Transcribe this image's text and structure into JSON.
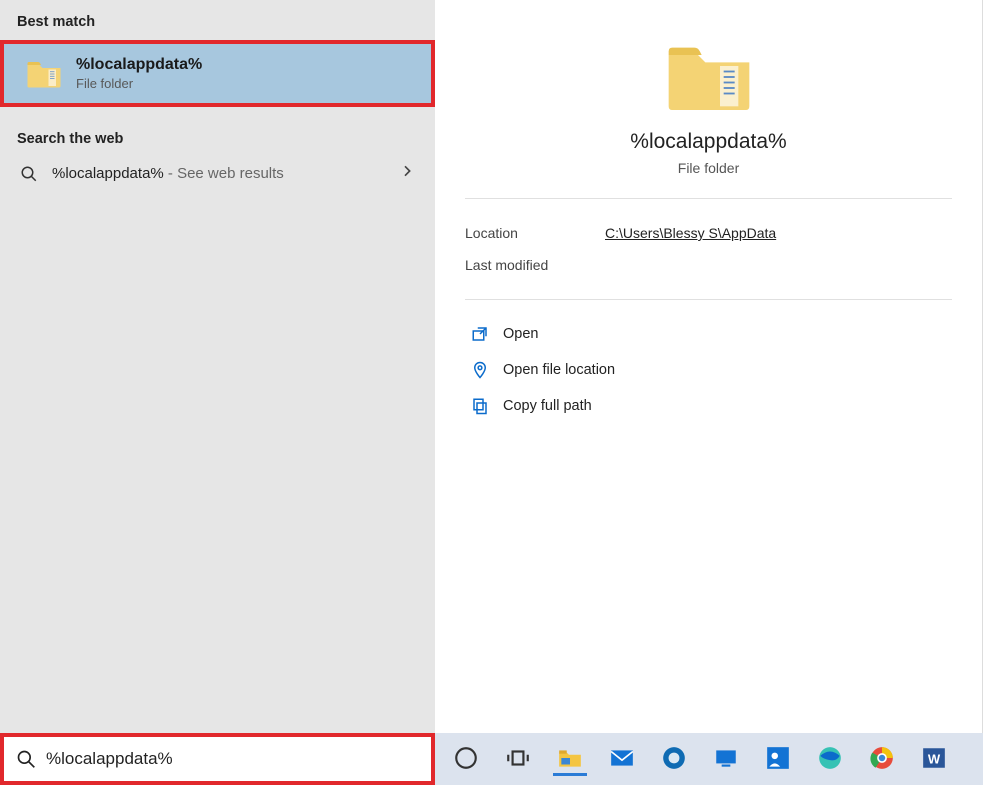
{
  "left": {
    "best_match_header": "Best match",
    "item_title": "%localappdata%",
    "item_sub": "File folder",
    "web_header": "Search the web",
    "web_query": "%localappdata%",
    "web_suffix": " - See web results"
  },
  "details": {
    "title": "%localappdata%",
    "sub": "File folder",
    "location_label": "Location",
    "location_value": "C:\\Users\\Blessy S\\AppData",
    "modified_label": "Last modified",
    "modified_value": "",
    "actions": {
      "open": "Open",
      "open_loc": "Open file location",
      "copy_path": "Copy full path"
    }
  },
  "search": {
    "value": "%localappdata%"
  },
  "taskbar": {
    "cortana": "cortana",
    "taskview": "task-view",
    "explorer": "file-explorer",
    "mail": "mail",
    "app5": "dell",
    "app6": "surface",
    "app7": "feedback",
    "edge": "edge",
    "chrome": "chrome",
    "word": "word"
  }
}
